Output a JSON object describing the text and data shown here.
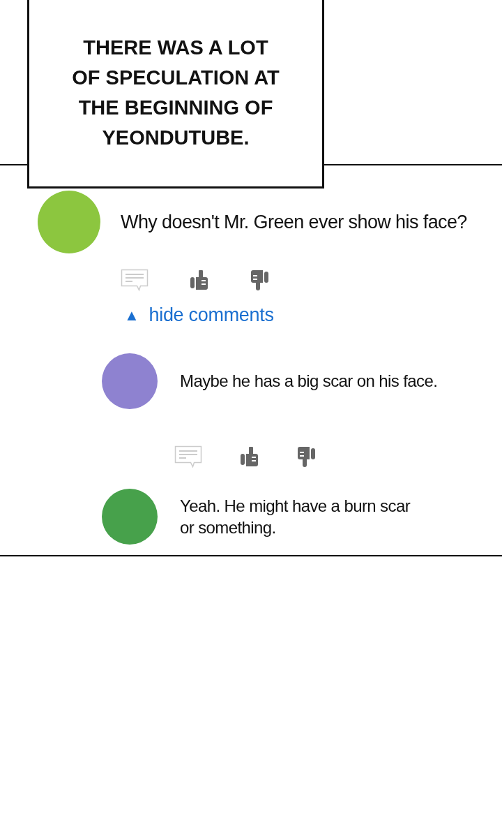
{
  "caption": "THERE WAS A LOT OF SPECULATION AT THE BEGINNING OF YEONDUTUBE.",
  "comments": [
    {
      "color": "#8cc63f",
      "text": "Why doesn't Mr. Green ever show his face?",
      "actions": true,
      "toggle": {
        "arrow": "▲",
        "label": "hide comments"
      },
      "replies": [
        {
          "color": "#8e82d0",
          "text": "Maybe he has a big scar on his face.",
          "actions": true
        },
        {
          "color": "#47a14b",
          "text": "Yeah. He might have a burn scar\nor something.",
          "actions": false
        }
      ]
    }
  ]
}
